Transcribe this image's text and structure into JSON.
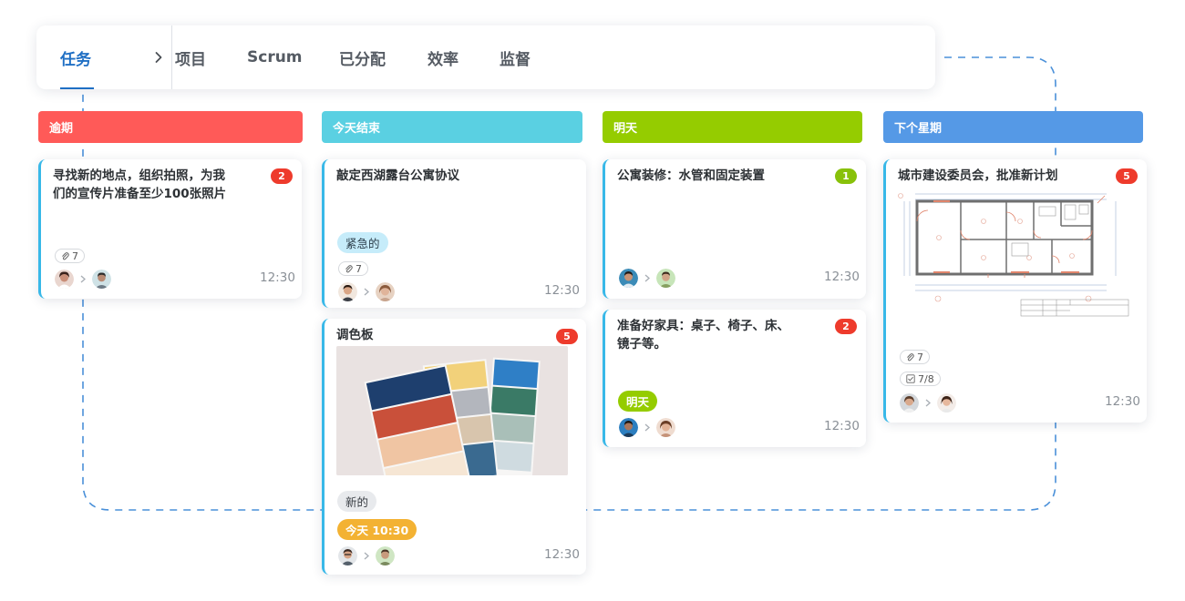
{
  "nav": {
    "active_tab": "任务",
    "tabs": [
      "项目",
      "Scrum",
      "已分配",
      "效率",
      "监督"
    ]
  },
  "columns": [
    {
      "label": "逾期",
      "color": "#ff5a58"
    },
    {
      "label": "今天结束",
      "color": "#5ad0e2"
    },
    {
      "label": "明天",
      "color": "#95cc00"
    },
    {
      "label": "下个星期",
      "color": "#5599e6"
    }
  ],
  "cards": {
    "c1": {
      "title_line1": "寻找新的地点，组织拍照，为我",
      "title_line2": "们的宣传片准备至少100张照片",
      "badge": "2",
      "attachments": "7",
      "time": "12:30"
    },
    "c2": {
      "title": "敲定西湖露台公寓协议",
      "tag": "紧急的",
      "attachments": "7",
      "time": "12:30"
    },
    "c3": {
      "title": "调色板",
      "badge": "5",
      "tag": "新的",
      "due_tag": "今天 10:30",
      "time": "12:30"
    },
    "c4": {
      "title": "公寓装修：水管和固定装置",
      "badge": "1",
      "time": "12:30"
    },
    "c5": {
      "title_line1": "准备好家具：桌子、椅子、床、",
      "title_line2": "镜子等。",
      "badge": "2",
      "tag": "明天",
      "time": "12:30"
    },
    "c6": {
      "title": "城市建设委员会，批准新计划",
      "badge": "5",
      "attachments": "7",
      "checklist": "7/8",
      "time": "12:30"
    }
  },
  "colors": {
    "badge_red": "#ee3b2c",
    "badge_green": "#88c10a",
    "accent_blue": "#1f6fc4",
    "card_border": "#38b8e8"
  },
  "icons": [
    "chevron-right-icon",
    "paperclip-icon",
    "checklist-icon",
    "arrow-right-icon"
  ]
}
